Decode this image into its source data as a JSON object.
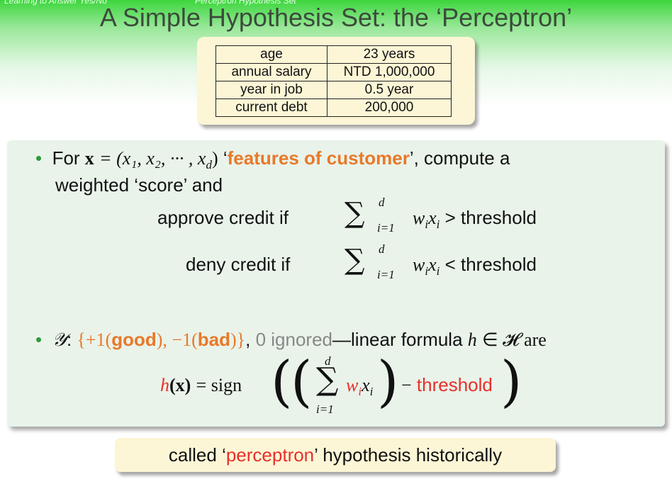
{
  "header": {
    "nav_left": "Learning to Answer Yes/No",
    "nav_right": "Perceptron Hypothesis Set",
    "title": "A Simple Hypothesis Set: the ‘Perceptron’"
  },
  "feature_table": {
    "rows": [
      {
        "name": "age",
        "value": "23 years"
      },
      {
        "name": "annual salary",
        "value": "NTD 1,000,000"
      },
      {
        "name": "year in job",
        "value": "0.5 year"
      },
      {
        "name": "current debt",
        "value": "200,000"
      }
    ]
  },
  "bullet1": {
    "prefix": "For",
    "x_bold": "x",
    "vector": "= (x₁, x₂, ··· , x",
    "vector_d": "d",
    "vector_end": ")",
    "quote_open": "‘",
    "highlight": "features of customer",
    "suffix": "’, compute a",
    "line2": "weighted ‘score’ and",
    "approve_label": "approve credit if",
    "deny_label": "deny credit if",
    "sum_top": "d",
    "sum_bottom": "i=1",
    "wx": "w",
    "wx_i": "i",
    "x_var": "x",
    "gt": "> threshold",
    "lt": "< threshold"
  },
  "bullet2": {
    "y_symbol": "𝒴",
    "colon": ":",
    "set_open": "{+1(",
    "good": "good",
    "mid": "), −1(",
    "bad": "bad",
    "set_close": ")}",
    "comma": ",",
    "zero_ignored": "0 ignored",
    "rest": "—linear formula",
    "h": "h",
    "in_H": "∈ 𝓗 are",
    "formula_h": "h",
    "formula_x": "(x)",
    "formula_eq": "= sign",
    "formula_w": "w",
    "formula_i": "i",
    "formula_xi": "x",
    "formula_minus": "−",
    "formula_threshold": "threshold",
    "formula_top": "d",
    "formula_bottom": "i=1"
  },
  "footer": {
    "pre": "called ‘",
    "highlight": "perceptron",
    "post": "’ hypothesis historically"
  }
}
